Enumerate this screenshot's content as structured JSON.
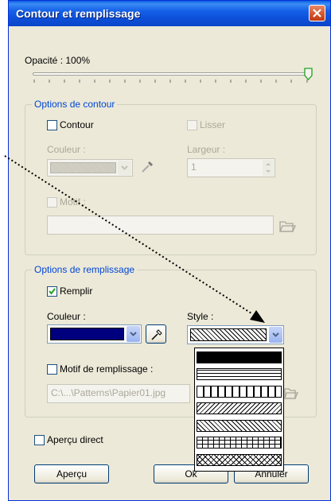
{
  "dialog": {
    "title": "Contour et remplissage"
  },
  "opacity": {
    "label": "Opacité : 100%",
    "value_percent": 100
  },
  "outline": {
    "legend": "Options de contour",
    "contour_label": "Contour",
    "smooth_label": "Lisser",
    "color_label": "Couleur :",
    "width_label": "Largeur :",
    "width_value": "1",
    "pattern_label": "Motif :"
  },
  "fill": {
    "legend": "Options de remplissage",
    "fill_label": "Remplir",
    "color_label": "Couleur :",
    "color_value": "#00007f",
    "style_label": "Style :",
    "pattern_fill_label": "Motif de remplissage :",
    "pattern_path": "C:\\...\\Patterns\\Papier01.jpg",
    "style_options": [
      "solid",
      "horizontal-lines",
      "vertical-lines",
      "diagonal-lines",
      "diagonal-lines-dense",
      "grid",
      "crosshatch"
    ]
  },
  "preview": {
    "direct_label": "Aperçu direct"
  },
  "buttons": {
    "preview": "Aperçu",
    "ok": "Ok",
    "cancel": "Annuler"
  },
  "colors": {
    "accent": "#0046d5",
    "titlebar": "#0a4fd8",
    "face": "#ece9d8"
  }
}
